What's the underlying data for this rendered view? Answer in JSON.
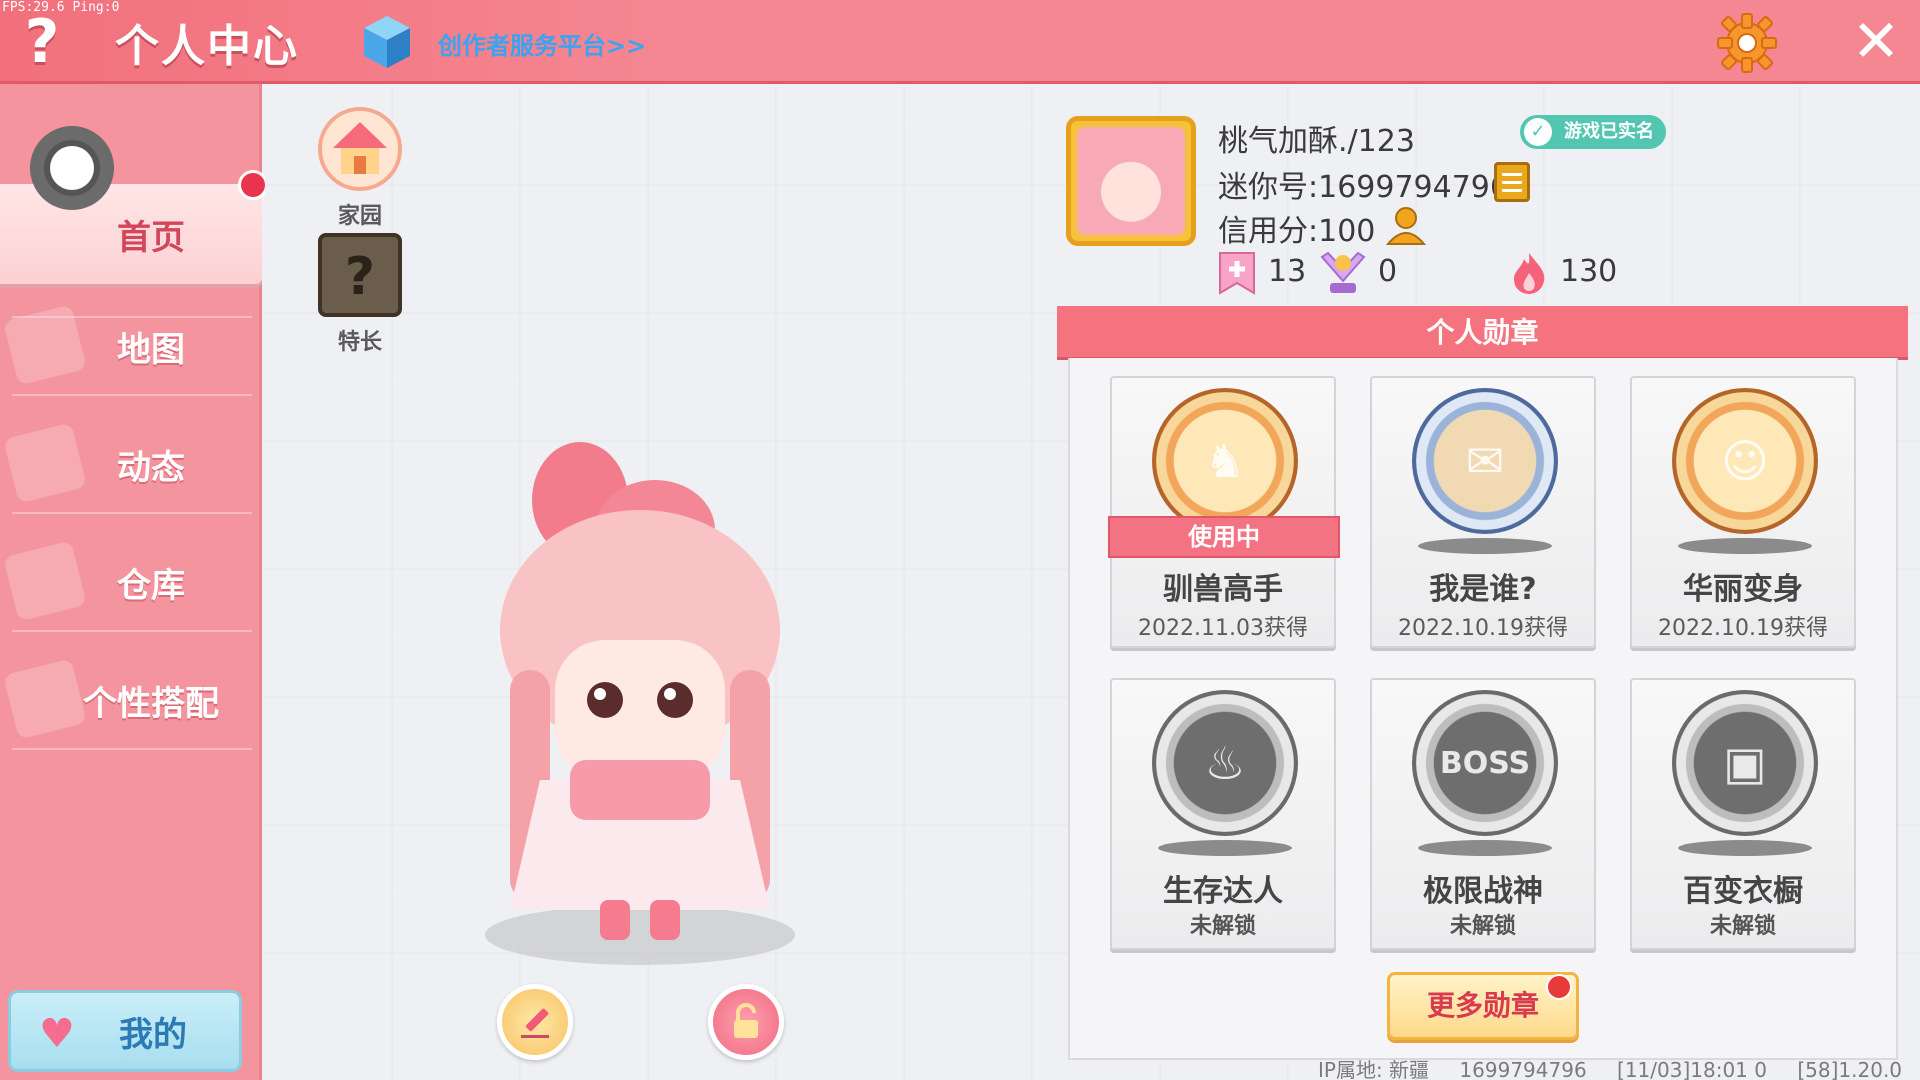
{
  "debug": {
    "fps_text": "FPS:29.6  Ping:0"
  },
  "header": {
    "help_glyph": "?",
    "title": "个人中心",
    "creator_link": "创作者服务平台>>",
    "close_glyph": "✕"
  },
  "sidebar": {
    "items": [
      {
        "label": "首页",
        "active": true
      },
      {
        "label": "地图"
      },
      {
        "label": "动态"
      },
      {
        "label": "仓库"
      },
      {
        "label": "个性搭配"
      }
    ],
    "mine_label": "我的"
  },
  "quick_links": [
    {
      "label": "家园",
      "icon": "house-icon"
    },
    {
      "label": "特长",
      "icon": "question-box-icon"
    }
  ],
  "profile": {
    "name": "桃气加酥./123",
    "verified_badge": "游戏已实名",
    "mini_id": "迷你号:1699794796",
    "credit": "信用分:100",
    "stats": [
      {
        "icon": "bookmark-plus-icon",
        "value": "13"
      },
      {
        "icon": "trophy-cup-icon",
        "value": "0"
      },
      {
        "icon": "flame-icon",
        "value": "130"
      }
    ]
  },
  "medals": {
    "title": "个人勋章",
    "items": [
      {
        "name": "驯兽高手",
        "sub": "2022.11.03获得",
        "status": "使用中",
        "style": "gold",
        "icon": "horse-rider-icon"
      },
      {
        "name": "我是谁?",
        "sub": "2022.10.19获得",
        "style": "blue",
        "icon": "envelope-icon"
      },
      {
        "name": "华丽变身",
        "sub": "2022.10.19获得",
        "style": "gold",
        "icon": "dino-costume-icon"
      },
      {
        "name": "生存达人",
        "sub": "未解锁",
        "style": "grey",
        "icon": "campfire-icon"
      },
      {
        "name": "极限战神",
        "sub": "未解锁",
        "style": "grey",
        "icon": "boss-sword-icon"
      },
      {
        "name": "百变衣橱",
        "sub": "未解锁",
        "style": "grey",
        "icon": "wardrobe-icon"
      }
    ],
    "more_label": "更多勋章"
  },
  "footer": {
    "ip_location": "IP属地: 新疆",
    "uid": "1699794796",
    "timestamp": "[11/03]18:01 0",
    "version": "[58]1.20.0"
  },
  "colors": {
    "accent": "#f4737e",
    "sidebar": "#f4949e",
    "background": "#eff0f4"
  }
}
